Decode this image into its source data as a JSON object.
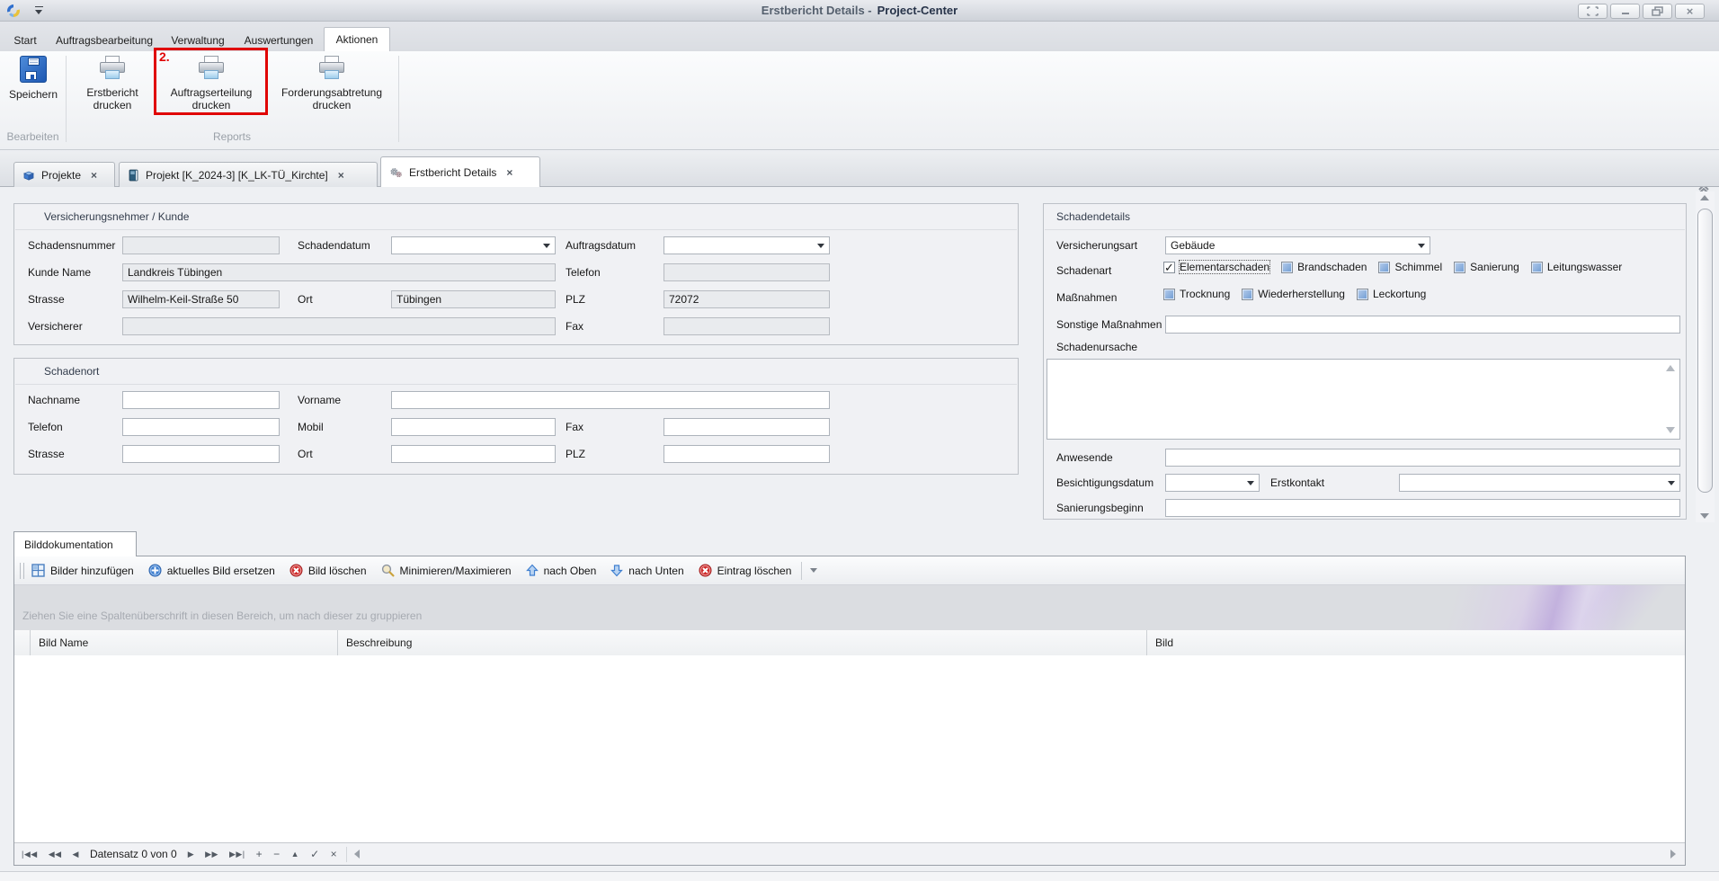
{
  "glyphs": {
    "check": "✓",
    "tab_close": "×",
    "window_close": "×",
    "nav_first": "|◀◀",
    "nav_prev_page": "◀◀",
    "nav_prev": "◀",
    "nav_next": "▶",
    "nav_next_page": "▶▶",
    "nav_last": "▶▶|",
    "nav_append": "+",
    "nav_delete": "−",
    "nav_edit": "▲",
    "nav_post": "✓",
    "nav_cancel": "×"
  },
  "titlebar": {
    "title_prefix": "Erstbericht Details -",
    "app_name": "Project-Center"
  },
  "ribbon": {
    "tabs": [
      "Start",
      "Auftragsbearbeitung",
      "Verwaltung",
      "Auswertungen",
      "Aktionen"
    ],
    "active_tab": "Aktionen",
    "buttons": {
      "speichern": "Speichern",
      "erstbericht": "Erstbericht drucken",
      "auftragserteilung": "Auftragserteilung drucken",
      "forderungsabtretung": "Forderungsabtretung drucken"
    },
    "group_labels": {
      "bearbeiten": "Bearbeiten",
      "reports": "Reports"
    },
    "annotation": "2.",
    "annotation_color": "#e00404"
  },
  "doc_tabs": [
    {
      "label": "Projekte",
      "icon": "projects-box-icon"
    },
    {
      "label": "Projekt [K_2024-3] [K_LK-TÜ_Kirchte]",
      "icon": "project-book-icon"
    },
    {
      "label": "Erstbericht Details",
      "icon": "report-gear-icon"
    }
  ],
  "kunde": {
    "title": "Versicherungsnehmer / Kunde",
    "labels": {
      "schadensnummer": "Schadensnummer",
      "schadendatum": "Schadendatum",
      "auftragsdatum": "Auftragsdatum",
      "kunde_name": "Kunde Name",
      "telefon": "Telefon",
      "strasse": "Strasse",
      "ort": "Ort",
      "plz": "PLZ",
      "versicherer": "Versicherer",
      "fax": "Fax"
    },
    "values": {
      "schadensnummer": "",
      "schadendatum": "",
      "auftragsdatum": "",
      "kunde_name": "Landkreis Tübingen",
      "telefon": "",
      "strasse": "Wilhelm-Keil-Straße 50",
      "ort": "Tübingen",
      "plz": "72072",
      "versicherer": "",
      "fax": ""
    }
  },
  "schadenort": {
    "title": "Schadenort",
    "labels": {
      "nachname": "Nachname",
      "vorname": "Vorname",
      "telefon": "Telefon",
      "mobil": "Mobil",
      "fax": "Fax",
      "strasse": "Strasse",
      "ort": "Ort",
      "plz": "PLZ"
    },
    "values": {
      "nachname": "",
      "vorname": "",
      "telefon": "",
      "mobil": "",
      "fax": "",
      "strasse": "",
      "ort": "",
      "plz": ""
    }
  },
  "schadendetails": {
    "title": "Schadendetails",
    "versicherungsart_label": "Versicherungsart",
    "versicherungsart_value": "Gebäude",
    "schadenart_label": "Schadenart",
    "schadenart_options": [
      {
        "label": "Elementarschaden",
        "checked": true
      },
      {
        "label": "Brandschaden",
        "checked": false
      },
      {
        "label": "Schimmel",
        "checked": false
      },
      {
        "label": "Sanierung",
        "checked": false
      },
      {
        "label": "Leitungswasser",
        "checked": false
      }
    ],
    "massnahmen_label": "Maßnahmen",
    "massnahmen_options": [
      {
        "label": "Trocknung",
        "checked": false
      },
      {
        "label": "Wiederherstellung",
        "checked": false
      },
      {
        "label": "Leckortung",
        "checked": false
      }
    ],
    "sonstige_label": "Sonstige Maßnahmen",
    "sonstige_value": "",
    "schadenursache_label": "Schadenursache",
    "schadenursache_value": "",
    "anwesende_label": "Anwesende",
    "anwesende_value": "",
    "besichtigungsdatum_label": "Besichtigungsdatum",
    "besichtigungsdatum_value": "",
    "erstkontakt_label": "Erstkontakt",
    "erstkontakt_value": "",
    "sanierungsbeginn_label": "Sanierungsbeginn",
    "sanierungsbeginn_value": ""
  },
  "bilddok": {
    "tab_label": "Bilddokumentation",
    "toolbar": [
      {
        "label": "Bilder hinzufügen",
        "icon": "add-images-icon"
      },
      {
        "label": "aktuelles Bild ersetzen",
        "icon": "replace-image-icon"
      },
      {
        "label": "Bild löschen",
        "icon": "delete-image-icon"
      },
      {
        "label": "Minimieren/Maximieren",
        "icon": "zoom-icon"
      },
      {
        "label": "nach Oben",
        "icon": "move-up-icon"
      },
      {
        "label": "nach Unten",
        "icon": "move-down-icon"
      },
      {
        "label": "Eintrag löschen",
        "icon": "delete-entry-icon"
      }
    ],
    "groupby_text": "Ziehen Sie eine Spaltenüberschrift in diesen Bereich, um nach dieser zu gruppieren",
    "columns": [
      "Bild Name",
      "Beschreibung",
      "Bild"
    ],
    "rows": [],
    "navigator_text": "Datensatz 0 von 0"
  }
}
